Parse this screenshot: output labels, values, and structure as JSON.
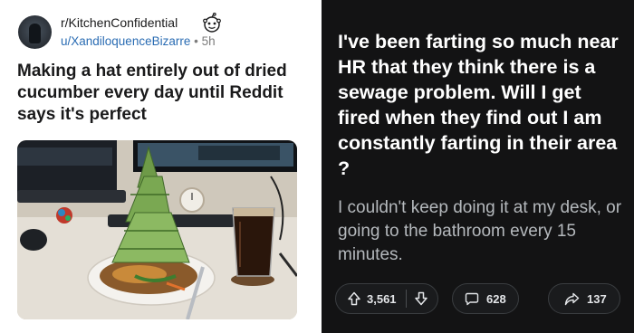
{
  "left_post": {
    "subreddit": "r/KitchenConfidential",
    "username": "u/XandiloquenceBizarre",
    "separator": "•",
    "age": "5h",
    "title": "Making a hat entirely out of dried cucumber every day until Reddit says it's perfect",
    "avatar_icon": "user-avatar",
    "badge_icon": "snoo-icon"
  },
  "right_post": {
    "title": "I've been farting so much near HR that they think there is a sewage problem. Will I get fired when they find out I am constantly farting in their area ?",
    "body": "I couldn't keep doing it at my desk, or going to the bathroom every 15 minutes.",
    "votes": "3,561",
    "comments": "628",
    "shares": "137",
    "theme": {
      "background": "#131314",
      "text": "#ffffff",
      "muted": "#b5b9bd"
    }
  }
}
